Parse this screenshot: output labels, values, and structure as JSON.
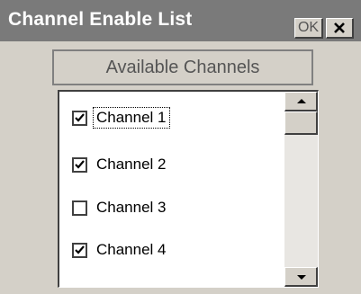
{
  "window": {
    "title": "Channel Enable List",
    "ok_label": "OK",
    "close_label": "✕"
  },
  "group_label": "Available Channels",
  "channels": [
    {
      "label": "Channel 1",
      "checked": true,
      "focused": true
    },
    {
      "label": "Channel 2",
      "checked": true,
      "focused": false
    },
    {
      "label": "Channel 3",
      "checked": false,
      "focused": false
    },
    {
      "label": "Channel 4",
      "checked": true,
      "focused": false
    }
  ],
  "scrollbar": {
    "up_icon": "arrow-up-icon",
    "down_icon": "arrow-down-icon"
  }
}
